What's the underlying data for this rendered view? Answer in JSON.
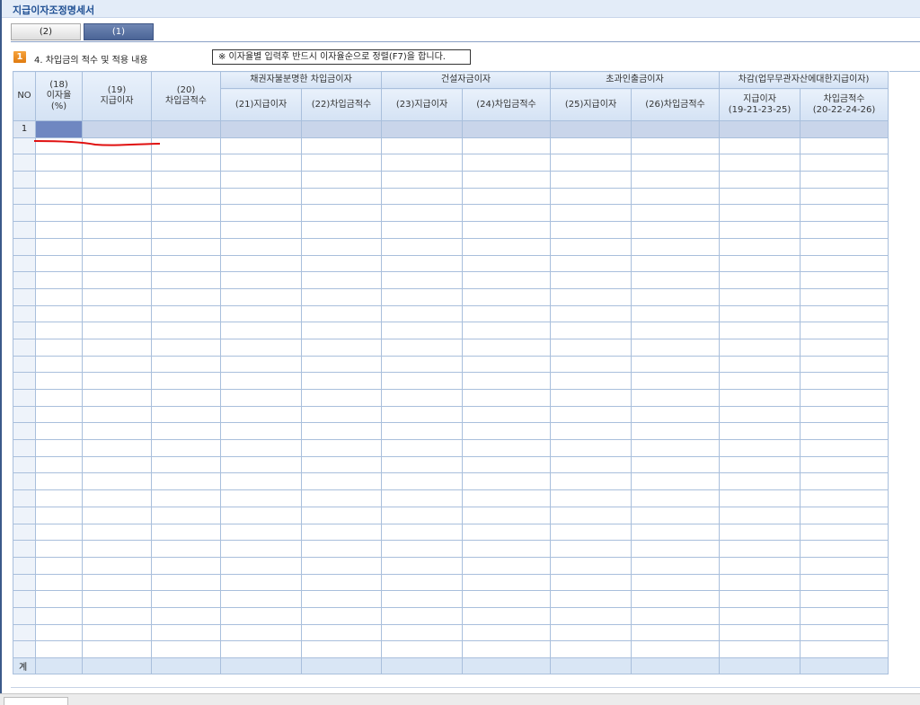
{
  "window": {
    "title": "지급이자조정명세서"
  },
  "tabs": [
    {
      "label": "(2)",
      "active": false
    },
    {
      "label": "(1)",
      "active": true
    }
  ],
  "section": {
    "badge": "1",
    "title": "4. 차입금의 적수 및 적용 내용",
    "notice": "※ 이자율별 입력후 반드시 이자율순으로 정렬(F7)을 합니다."
  },
  "grid": {
    "headers": {
      "no": "NO",
      "c18": [
        "(18)",
        "이자율",
        "(%)"
      ],
      "c19": [
        "(19)",
        "지급이자"
      ],
      "c20": [
        "(20)",
        "차입금적수"
      ],
      "group1": "채권자불분명한 차입금이자",
      "c21": "(21)지급이자",
      "c22": "(22)차입금적수",
      "group2": "건설자금이자",
      "c23": "(23)지급이자",
      "c24": "(24)차입금적수",
      "group3": "초과인출금이자",
      "c25": "(25)지급이자",
      "c26": "(26)차입금적수",
      "group4": "차감(업무무관자산에대한지급이자)",
      "c27": [
        "지급이자",
        "(19-21-23-25)"
      ],
      "c28": [
        "차입금적수",
        "(20-22-24-26)"
      ]
    },
    "first_row_no": "1",
    "empty_rows": 31,
    "total_label": "계"
  },
  "colors": {
    "header_bg": "#dbe7f6",
    "selected_cell": "#6f87c1",
    "annotation_red": "#e01010",
    "title_text": "#1f4f93"
  }
}
